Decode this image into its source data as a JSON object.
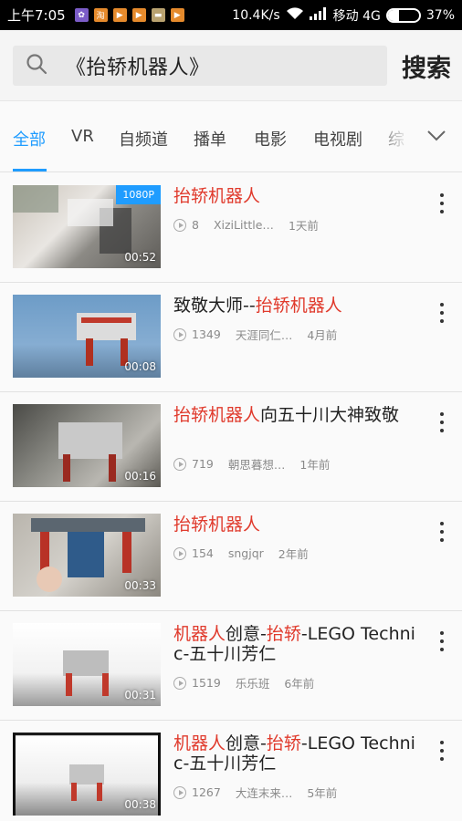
{
  "status": {
    "time": "上午7:05",
    "speed": "10.4K/s",
    "carrier": "移动 4G",
    "battery": "37%",
    "battery_level": 0.37
  },
  "search": {
    "query": "《抬轿机器人》",
    "button": "搜索"
  },
  "tabs": [
    "全部",
    "VR",
    "自频道",
    "播单",
    "电影",
    "电视剧",
    "综"
  ],
  "videos": [
    {
      "title": "抬轿机器人",
      "views": "8",
      "uploader": "XiziLittle…",
      "time": "1天前",
      "duration": "00:52",
      "badge": "1080P"
    },
    {
      "title": "致敬大师--抬轿机器人",
      "views": "1349",
      "uploader": "天涯同仁…",
      "time": "4月前",
      "duration": "00:08",
      "badge": ""
    },
    {
      "title": "抬轿机器人向五十川大神致敬",
      "views": "719",
      "uploader": "朝思暮想…",
      "time": "1年前",
      "duration": "00:16",
      "badge": ""
    },
    {
      "title": "抬轿机器人",
      "views": "154",
      "uploader": "sngjqr",
      "time": "2年前",
      "duration": "00:33",
      "badge": ""
    },
    {
      "title": "机器人创意-抬轿-LEGO Technic-五十川芳仁",
      "views": "1519",
      "uploader": "乐乐班",
      "time": "6年前",
      "duration": "00:31",
      "badge": ""
    },
    {
      "title": "机器人创意-抬轿-LEGO Technic-五十川芳仁",
      "views": "1267",
      "uploader": "大连末来…",
      "time": "5年前",
      "duration": "00:38",
      "badge": ""
    }
  ],
  "colors": {
    "accent": "#1f9cff",
    "highlight": "#e03a2c"
  }
}
